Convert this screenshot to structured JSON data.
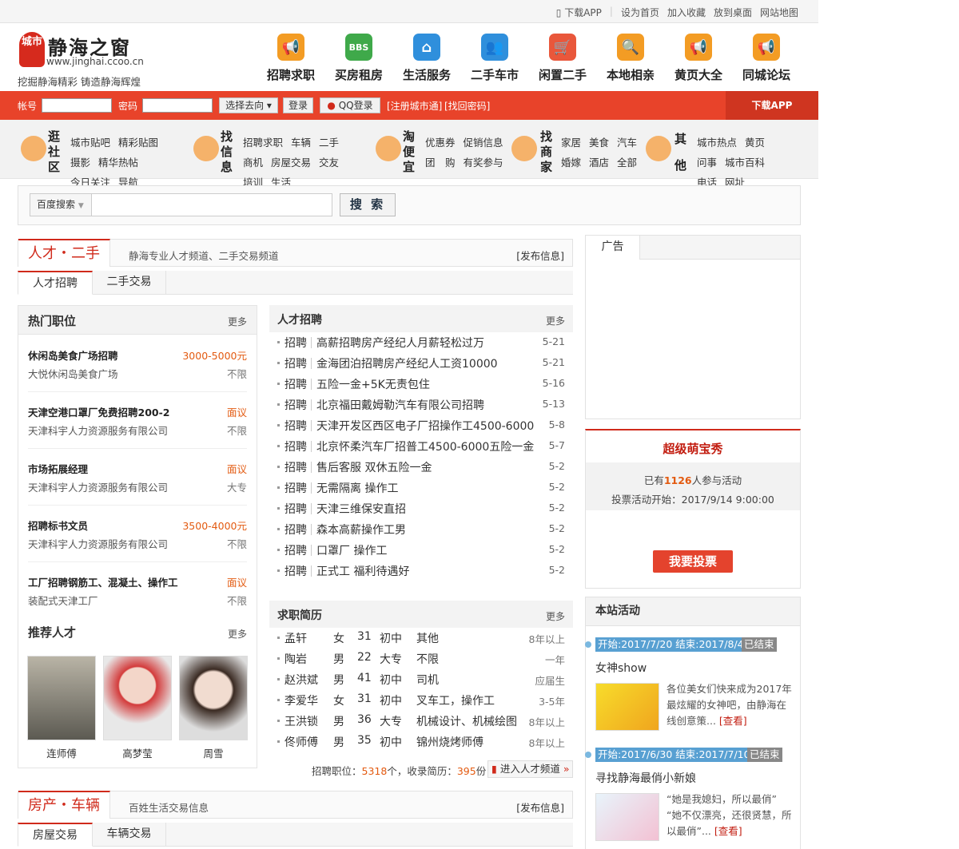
{
  "topbar": {
    "links": [
      "下载APP",
      "设为首页",
      "加入收藏",
      "放到桌面",
      "网站地图"
    ]
  },
  "logo": {
    "mark": "城市",
    "name": "静海之窗",
    "url": "www.jinghai.ccoo.cn",
    "slogan": "挖掘静海精彩 铸造静海辉煌"
  },
  "nav": [
    {
      "label": "招聘求职",
      "icon": "megaphone-icon",
      "color": "#f39c24"
    },
    {
      "label": "买房租房",
      "icon": "bbs-icon",
      "color": "#3fa94a"
    },
    {
      "label": "生活服务",
      "icon": "house-icon",
      "color": "#2f8fdc"
    },
    {
      "label": "二手车市",
      "icon": "users-icon",
      "color": "#2f8fdc"
    },
    {
      "label": "闲置二手",
      "icon": "cart-icon",
      "color": "#e9573b"
    },
    {
      "label": "本地相亲",
      "icon": "search-icon",
      "color": "#f39c24"
    },
    {
      "label": "黄页大全",
      "icon": "megaphone-icon",
      "color": "#f39c24"
    },
    {
      "label": "同城论坛",
      "icon": "megaphone-icon",
      "color": "#f39c24"
    }
  ],
  "login": {
    "account_label": "帐号",
    "password_label": "密码",
    "select_label": "选择去向",
    "login_button": "登录",
    "qq_button": "QQ登录",
    "register_link": "[注册城市通]",
    "forgot_link": "[找回密码]",
    "download_app": "下载APP"
  },
  "channels": [
    {
      "title": "逛社区",
      "links": [
        "城市贴吧",
        "精彩贴图",
        "摄影",
        "精华热帖",
        "今日关注",
        "导航"
      ]
    },
    {
      "title": "找信息",
      "links": [
        "招聘求职",
        "车辆",
        "二手",
        "商机",
        "房屋交易",
        "交友",
        "培训",
        "生活"
      ]
    },
    {
      "title": "淘便宜",
      "links": [
        "优惠券",
        "促销信息",
        "团　购",
        "有奖参与"
      ]
    },
    {
      "title": "找商家",
      "links": [
        "家居",
        "美食",
        "汽车",
        "婚嫁",
        "酒店",
        "全部"
      ]
    },
    {
      "title": "其他",
      "links": [
        "城市热点",
        "黄页",
        "问事",
        "城市百科",
        "电话",
        "网址"
      ]
    }
  ],
  "search": {
    "engine": "百度搜索",
    "button": "搜 索"
  },
  "talent_section": {
    "title": "人才・二手",
    "subtitle": "静海专业人才频道、二手交易频道",
    "publish": "[发布信息]",
    "tabs": [
      "人才招聘",
      "二手交易"
    ]
  },
  "hot_jobs": {
    "title": "热门职位",
    "more": "更多",
    "items": [
      {
        "title": "休闲岛美食广场招聘",
        "salary": "3000-5000元",
        "company": "大悦休闲岛美食广场",
        "req": "不限"
      },
      {
        "title": "天津空港口罩厂免费招聘200-2",
        "salary": "面议",
        "company": "天津科宇人力资源服务有限公司",
        "req": "不限"
      },
      {
        "title": "市场拓展经理",
        "salary": "面议",
        "company": "天津科宇人力资源服务有限公司",
        "req": "大专"
      },
      {
        "title": "招聘标书文员",
        "salary": "3500-4000元",
        "company": "天津科宇人力资源服务有限公司",
        "req": "不限"
      },
      {
        "title": "工厂招聘钢筋工、混凝土、操作工",
        "salary": "面议",
        "company": "装配式天津工厂",
        "req": "不限"
      }
    ]
  },
  "recommend": {
    "title": "推荐人才",
    "more": "更多",
    "people": [
      "连师傅",
      "高梦莹",
      "周雪"
    ]
  },
  "recruit": {
    "title": "人才招聘",
    "more": "更多",
    "items": [
      {
        "tag": "招聘",
        "text": "高薪招聘房产经纪人月薪轻松过万",
        "date": "5-21"
      },
      {
        "tag": "招聘",
        "text": "金海团泊招聘房产经纪人工资10000",
        "date": "5-21"
      },
      {
        "tag": "招聘",
        "text": "五险一金+5K无责包住",
        "date": "5-16"
      },
      {
        "tag": "招聘",
        "text": "北京福田戴姆勒汽车有限公司招聘",
        "date": "5-13"
      },
      {
        "tag": "招聘",
        "text": "天津开发区西区电子厂招操作工4500-6000",
        "date": "5-8"
      },
      {
        "tag": "招聘",
        "text": "北京怀柔汽车厂招普工4500-6000五险一金",
        "date": "5-7"
      },
      {
        "tag": "招聘",
        "text": "售后客服 双休五险一金",
        "date": "5-2"
      },
      {
        "tag": "招聘",
        "text": "无需隔离 操作工",
        "date": "5-2"
      },
      {
        "tag": "招聘",
        "text": "天津三维保安直招",
        "date": "5-2"
      },
      {
        "tag": "招聘",
        "text": "森本高薪操作工男",
        "date": "5-2"
      },
      {
        "tag": "招聘",
        "text": "口罩厂 操作工",
        "date": "5-2"
      },
      {
        "tag": "招聘",
        "text": "正式工 福利待遇好",
        "date": "5-2"
      }
    ]
  },
  "resumes": {
    "title": "求职简历",
    "more": "更多",
    "items": [
      {
        "name": "孟轩",
        "gender": "女",
        "age": "31",
        "edu": "初中",
        "job": "其他",
        "exp": "8年以上"
      },
      {
        "name": "陶岩",
        "gender": "男",
        "age": "22",
        "edu": "大专",
        "job": "不限",
        "exp": "一年"
      },
      {
        "name": "赵洪斌",
        "gender": "男",
        "age": "41",
        "edu": "初中",
        "job": "司机",
        "exp": "应届生"
      },
      {
        "name": "李爱华",
        "gender": "女",
        "age": "31",
        "edu": "初中",
        "job": "叉车工，操作工",
        "exp": "3-5年"
      },
      {
        "name": "王洪锁",
        "gender": "男",
        "age": "36",
        "edu": "大专",
        "job": "机械设计、机械绘图",
        "exp": "8年以上"
      },
      {
        "name": "佟师傅",
        "gender": "男",
        "age": "35",
        "edu": "初中",
        "job": "锦州烧烤师傅",
        "exp": "8年以上"
      }
    ]
  },
  "stats": {
    "jobs_label": "招聘职位：",
    "jobs": "5318",
    "jobs_unit": "个，收录简历：",
    "resumes": "395",
    "resumes_unit": "份",
    "enter": "进入人才频道"
  },
  "house_section": {
    "title": "房产・车辆",
    "subtitle": "百姓生活交易信息",
    "publish": "[发布信息]",
    "tabs": [
      "房屋交易",
      "车辆交易"
    ]
  },
  "ad": {
    "title": "广告"
  },
  "vote": {
    "title": "超级萌宝秀",
    "count_prefix": "已有",
    "count": "1126",
    "count_suffix": "人参与活动",
    "start": "投票活动开始：2017/9/14 9:00:00",
    "button": "我要投票"
  },
  "activities": {
    "title": "本站活动",
    "items": [
      {
        "date": "开始:2017/7/20 结束:2017/8/4",
        "status": "已结束",
        "title": "女神show",
        "desc": "各位美女们快来成为2017年最炫耀的女神吧，由静海在线创意策...",
        "more": "[查看]"
      },
      {
        "date": "开始:2017/6/30 结束:2017/7/10",
        "status": "已结束",
        "title": "寻找静海最俏小新娘",
        "desc": "“她是我媳妇，所以最俏” “她不仅漂亮，还很贤慧，所以最俏”...",
        "more": "[查看]"
      }
    ]
  }
}
